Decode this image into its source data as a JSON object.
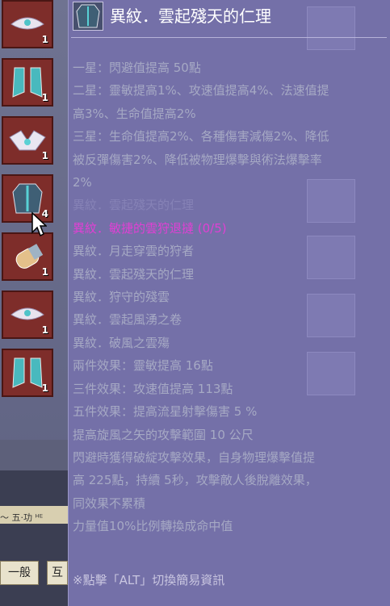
{
  "inventory": {
    "slots": [
      {
        "icon": "wing-crown-icon",
        "count": "1"
      },
      {
        "icon": "teal-boots-icon",
        "count": "1"
      },
      {
        "icon": "wing-helmet-icon",
        "count": "1"
      },
      {
        "icon": "ornate-armor-icon",
        "count": "4"
      },
      {
        "icon": "gauntlet-icon",
        "count": "1"
      },
      {
        "icon": "wing-crown-icon",
        "count": "1"
      },
      {
        "icon": "teal-boots-icon",
        "count": "1"
      }
    ],
    "cut_text": "～ 五·功 ᴴᴱ",
    "tab_general": "一般",
    "tab_partial": "互"
  },
  "tooltip": {
    "title": "異紋．雲起殘天的仁理",
    "lines": [
      {
        "text": "一星：閃避值提高 50點",
        "style": "normal"
      },
      {
        "text": "二星：靈敏提高1%、攻速值提高4%、法速值提",
        "style": "normal"
      },
      {
        "text": "高3%、生命值提高2%",
        "style": "normal"
      },
      {
        "text": "三星：生命值提高2%、各種傷害減傷2%、降低",
        "style": "normal"
      },
      {
        "text": "被反彈傷害2%、降低被物理爆擊與術法爆擊率",
        "style": "normal"
      },
      {
        "text": "2%",
        "style": "normal"
      },
      {
        "text": "異紋．雲起殘天的仁理",
        "style": "faint"
      },
      {
        "text": "異紋．敏捷的雲狩退撻 (0/5)",
        "style": "magenta"
      },
      {
        "text": "異紋．月走穿雲的狩者",
        "style": "normal"
      },
      {
        "text": "異紋．雲起殘天的仁理",
        "style": "normal"
      },
      {
        "text": "異紋．狩守的殘雲",
        "style": "normal"
      },
      {
        "text": "異紋．雲起風湧之卷",
        "style": "normal"
      },
      {
        "text": "異紋．破風之雲殤",
        "style": "normal"
      },
      {
        "text": "兩件效果：靈敏提高 16點",
        "style": "normal"
      },
      {
        "text": "三件效果：攻速值提高 113點",
        "style": "normal"
      },
      {
        "text": "五件效果：提高流星射擊傷害 5 %",
        "style": "normal"
      },
      {
        "text": "提高旋風之矢的攻擊範圍 10 公尺",
        "style": "normal"
      },
      {
        "text": "閃避時獲得破綻攻擊效果，自身物理爆擊值提",
        "style": "normal"
      },
      {
        "text": "高 225點，持續 5秒，攻擊敵人後脫離效果，",
        "style": "normal"
      },
      {
        "text": "同效果不累積",
        "style": "normal"
      },
      {
        "text": "力量值10%比例轉換成命中值",
        "style": "normal"
      }
    ],
    "footer": "※點擊「ALT」切換簡易資訊"
  },
  "colors": {
    "panel": "#7470a8",
    "title": "#ffffff",
    "text": "#a6a9c4",
    "set_name": "#e040d4",
    "slot": "#7e2d2a"
  }
}
